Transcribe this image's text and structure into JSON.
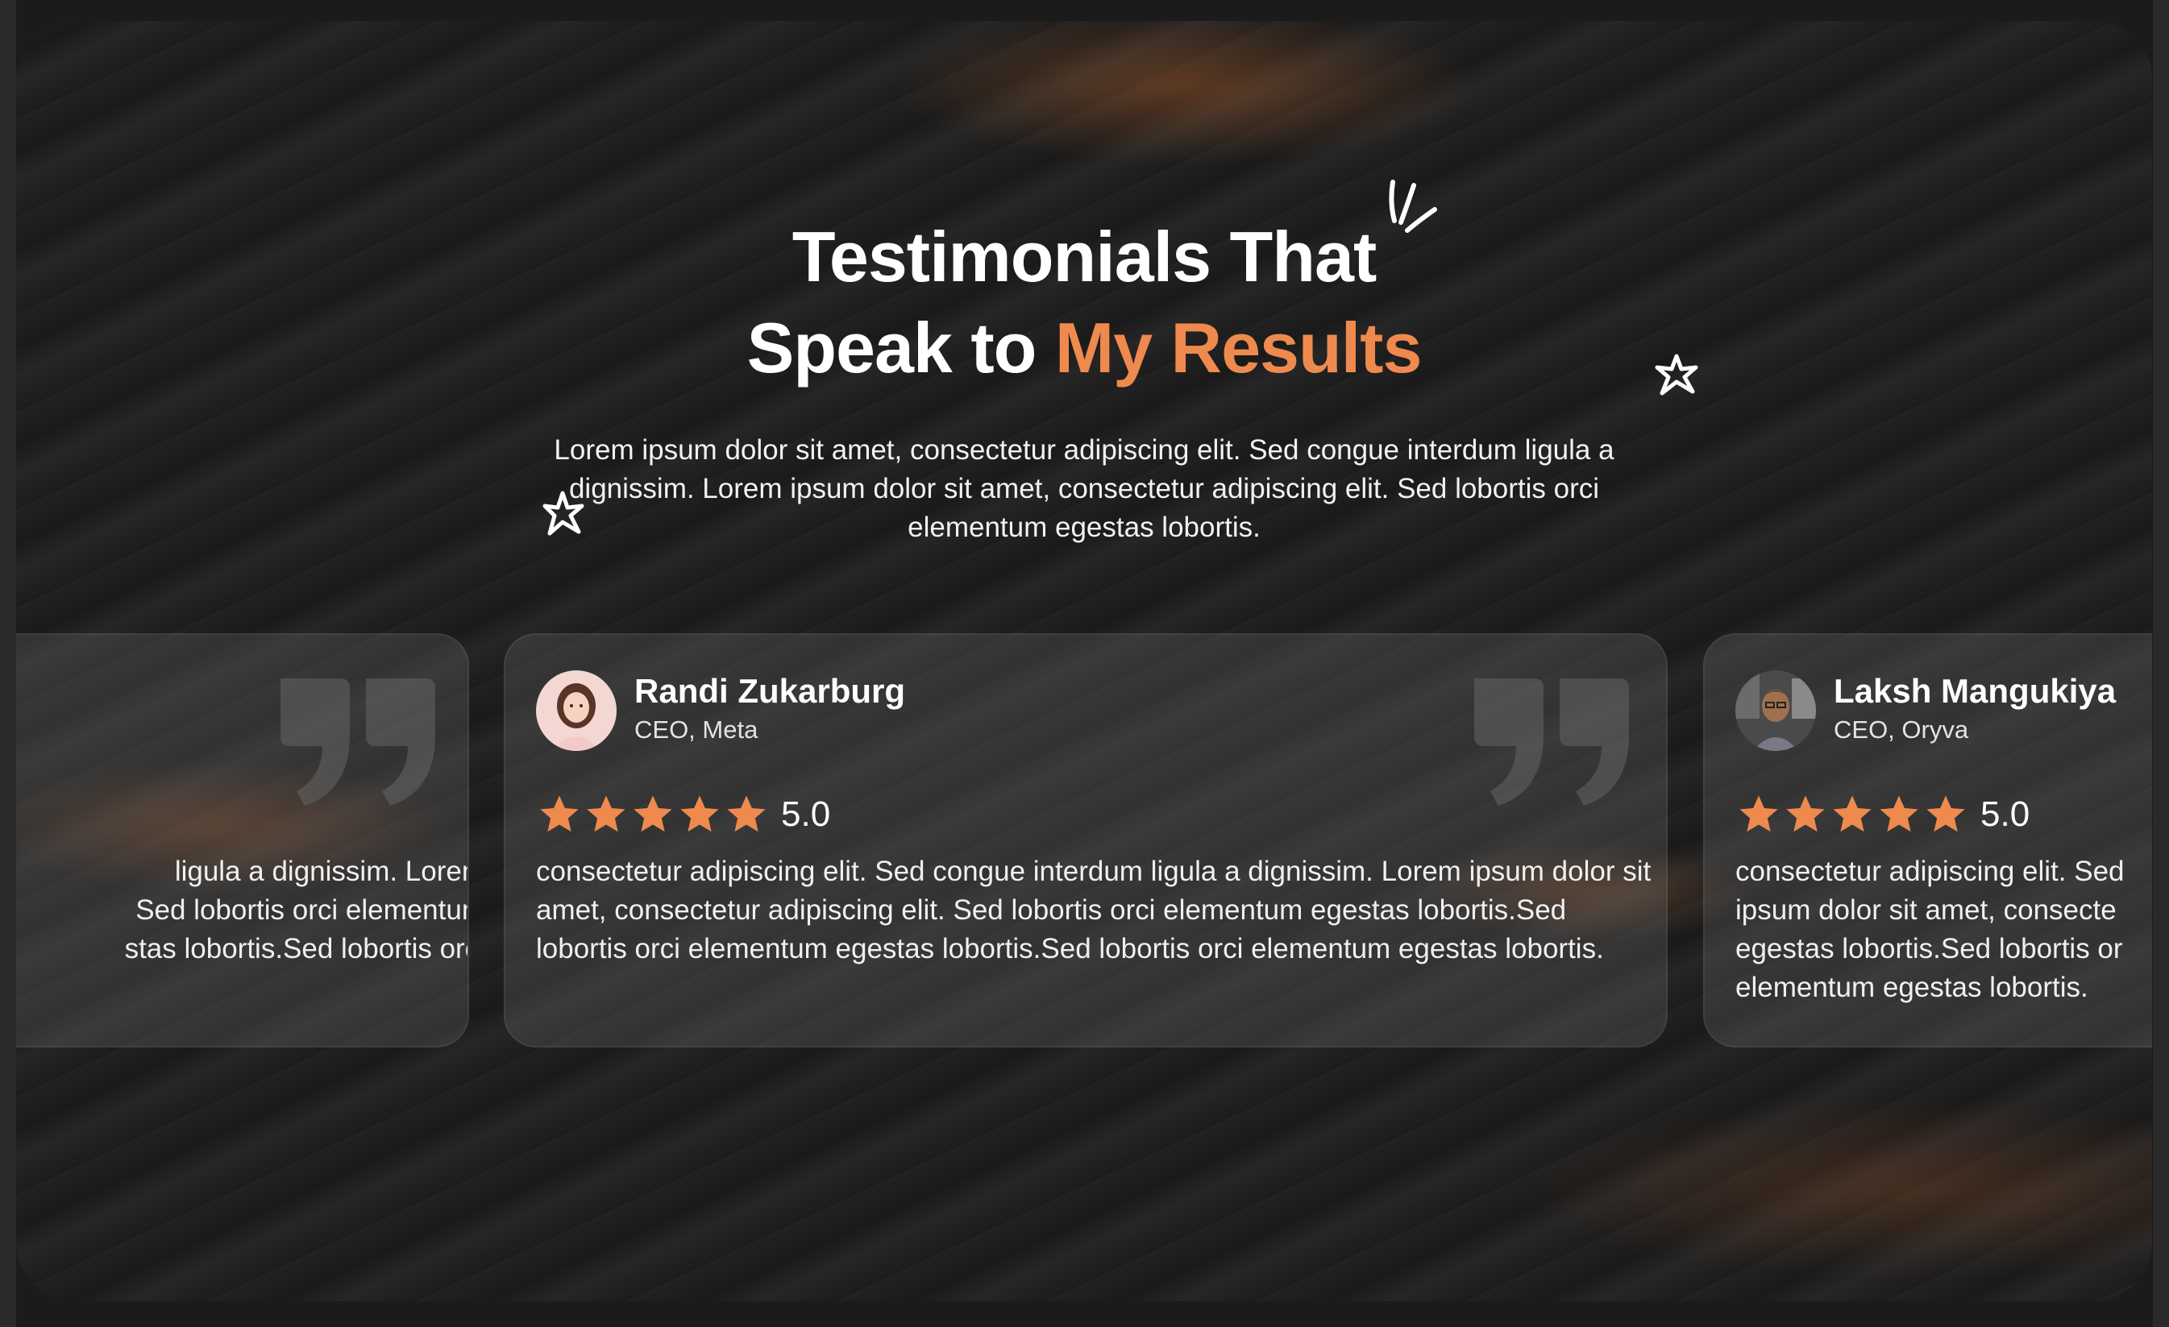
{
  "section": {
    "heading_line1": "Testimonials That",
    "heading_line2_plain": "Speak to",
    "heading_line2_accent": "My Results",
    "description": "Lorem ipsum dolor sit amet, consectetur adipiscing elit. Sed congue interdum ligula a dignissim. Lorem ipsum dolor sit amet, consectetur adipiscing elit. Sed lobortis orci elementum egestas lobortis."
  },
  "colors": {
    "accent": "#ee8a4e",
    "star": "#ee8a4e",
    "background": "#1c1c1c"
  },
  "testimonials": [
    {
      "name": "",
      "role": "",
      "rating": "",
      "body_lines": [
        "ligula a dignissim. Lorem",
        "Sed lobortis orci elementum",
        "stas lobortis.Sed lobortis orci"
      ]
    },
    {
      "name": "Randi Zukarburg",
      "role": "CEO, Meta",
      "rating": "5.0",
      "stars": 5,
      "avatar_icon": "woman-portrait-avatar",
      "body": "consectetur adipiscing elit. Sed congue interdum ligula a dignissim. Lorem ipsum dolor sit amet, consectetur adipiscing elit. Sed lobortis orci elementum egestas lobortis.Sed lobortis orci elementum egestas lobortis.Sed lobortis orci elementum egestas lobortis."
    },
    {
      "name": "Laksh Mangukiya",
      "role": "CEO, Oryva",
      "rating": "5.0",
      "stars": 5,
      "avatar_icon": "man-portrait-avatar",
      "body_lines": [
        "consectetur adipiscing elit. Sed",
        "ipsum dolor sit amet, consecte",
        "egestas lobortis.Sed lobortis or",
        "elementum egestas lobortis."
      ]
    }
  ],
  "icons": [
    "quote-mark-icon",
    "star-icon",
    "sparkle-star-icon",
    "accent-lines-icon"
  ]
}
